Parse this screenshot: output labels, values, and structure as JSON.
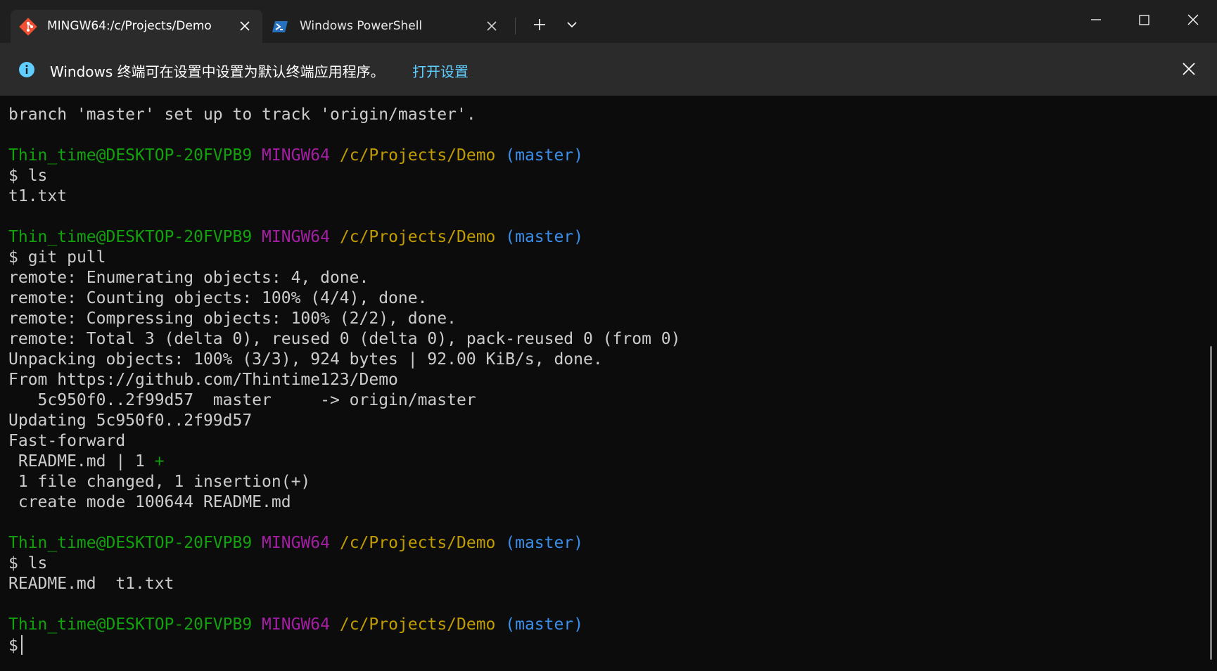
{
  "tabs": [
    {
      "title": "MINGW64:/c/Projects/Demo",
      "icon": "git-icon",
      "active": true
    },
    {
      "title": "Windows PowerShell",
      "icon": "powershell-icon",
      "active": false
    }
  ],
  "tabstrip": {
    "new_tab": "+",
    "dropdown": "⌄"
  },
  "infobar": {
    "message": "Windows 终端可在设置中设置为默认终端应用程序。",
    "link": "打开设置"
  },
  "colors": {
    "user_host": "#13a10e",
    "shell": "#a31ea3",
    "path": "#c19c00",
    "branch": "#3b8eea",
    "text": "#cccccc",
    "link": "#60cdff"
  },
  "prompt": {
    "user_host": "Thin_time@DESKTOP-20FVPB9",
    "shell": "MINGW64",
    "path": "/c/Projects/Demo",
    "branch": "(master)",
    "symbol": "$"
  },
  "terminal": {
    "out_0": "branch 'master' set up to track 'origin/master'.",
    "cmd_1": " ls",
    "out_1": "t1.txt",
    "cmd_2": " git pull",
    "out_2a": "remote: Enumerating objects: 4, done.",
    "out_2b": "remote: Counting objects: 100% (4/4), done.",
    "out_2c": "remote: Compressing objects: 100% (2/2), done.",
    "out_2d": "remote: Total 3 (delta 0), reused 0 (delta 0), pack-reused 0 (from 0)",
    "out_2e": "Unpacking objects: 100% (3/3), 924 bytes | 92.00 KiB/s, done.",
    "out_2f": "From https://github.com/Thintime123/Demo",
    "out_2g": "   5c950f0..2f99d57  master     -> origin/master",
    "out_2h": "Updating 5c950f0..2f99d57",
    "out_2i": "Fast-forward",
    "out_2j": " README.md | 1 ",
    "out_2j_plus": "+",
    "out_2k": " 1 file changed, 1 insertion(+)",
    "out_2l": " create mode 100644 README.md",
    "cmd_3": " ls",
    "out_3": "README.md  t1.txt"
  }
}
